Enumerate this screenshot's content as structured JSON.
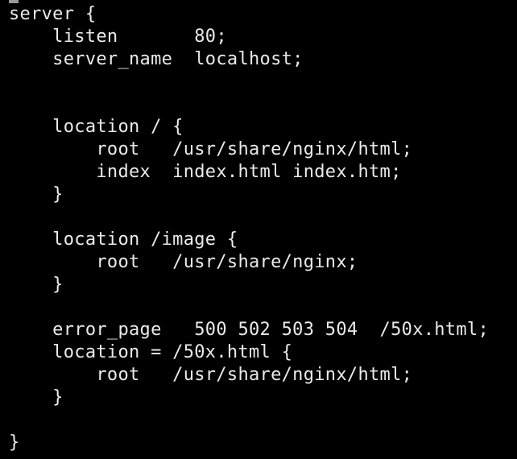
{
  "terminal": {
    "background": "#000000",
    "foreground": "#eaeaea",
    "lines": [
      "server {",
      "    listen       80;",
      "    server_name  localhost;",
      "",
      "",
      "    location / {",
      "        root   /usr/share/nginx/html;",
      "        index  index.html index.htm;",
      "    }",
      "",
      "    location /image {",
      "        root   /usr/share/nginx;",
      "    }",
      "",
      "    error_page   500 502 503 504  /50x.html;",
      "    location = /50x.html {",
      "        root   /usr/share/nginx/html;",
      "    }",
      "",
      "}"
    ]
  }
}
